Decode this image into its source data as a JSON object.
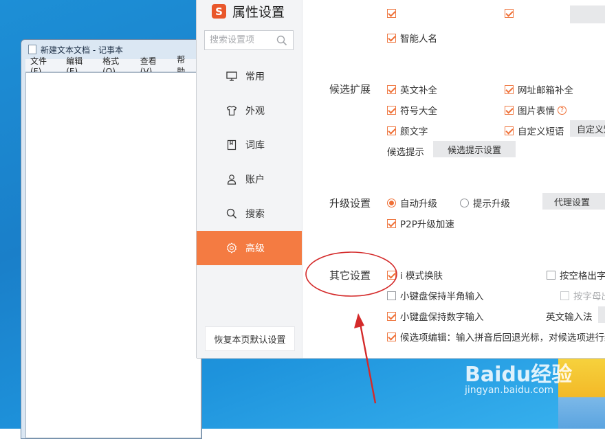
{
  "notepad": {
    "title": "新建文本文档 - 记事本",
    "menu": [
      "文件(F)",
      "编辑(E)",
      "格式(O)",
      "查看(V)",
      "帮助"
    ]
  },
  "settings": {
    "title": "属性设置",
    "logo_char": "S",
    "search_placeholder": "搜索设置项",
    "nav": [
      {
        "label": "常用",
        "icon": "monitor-icon"
      },
      {
        "label": "外观",
        "icon": "shirt-icon"
      },
      {
        "label": "词库",
        "icon": "book-icon"
      },
      {
        "label": "账户",
        "icon": "user-icon"
      },
      {
        "label": "搜索",
        "icon": "search-icon"
      },
      {
        "label": "高级",
        "icon": "gear-icon",
        "active": true
      }
    ],
    "restore_button": "恢复本页默认设置",
    "top_partial": {
      "smart_name": "智能人名"
    },
    "candidate_ext": {
      "label": "候选扩展",
      "options": [
        "英文补全",
        "网址邮箱补全",
        "符号大全",
        "图片表情",
        "颜文字",
        "自定义短语"
      ],
      "custom_phrase_button": "自定义短语设置",
      "hint_label": "候选提示",
      "hint_button": "候选提示设置"
    },
    "upgrade": {
      "label": "升级设置",
      "auto": "自动升级",
      "prompt": "提示升级",
      "proxy_button": "代理设置",
      "p2p": "P2P升级加速"
    },
    "other": {
      "label": "其它设置",
      "options": [
        "i 模式换肤",
        "小键盘保持半角输入",
        "小键盘保持数字输入",
        "候选项编辑：输入拼音后回退光标，对候选项进行编辑"
      ],
      "space_output": "按空格出字",
      "letter_output": "按字母出",
      "english_ime": "英文输入法"
    }
  },
  "watermark": {
    "logo": "Baidu经验",
    "url": "jingyan.baidu.com"
  },
  "colors": {
    "accent": "#f47b42",
    "annotation_red": "#d42a2a",
    "desktop_blue": "#1a86cf"
  }
}
